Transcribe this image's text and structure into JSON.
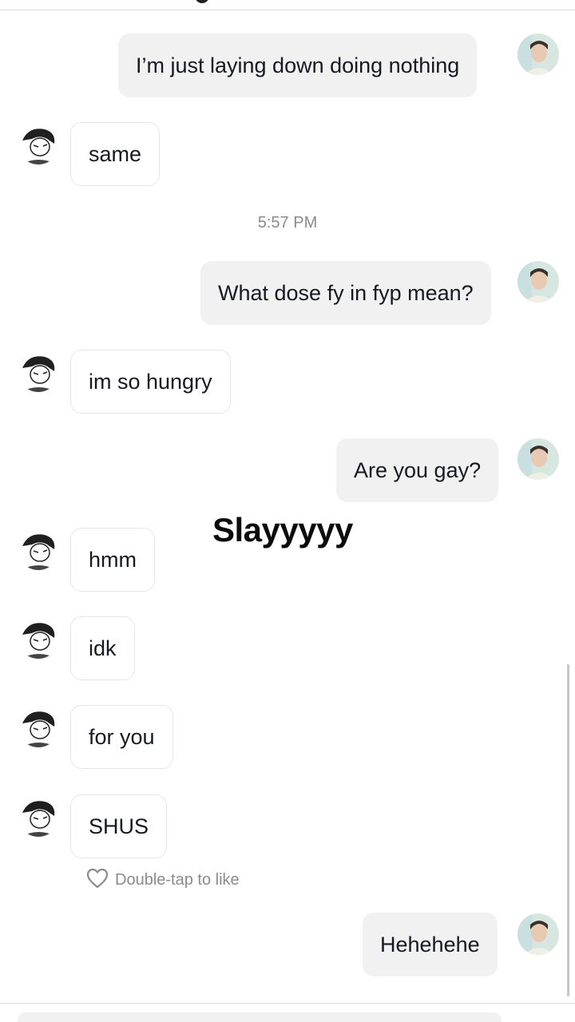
{
  "messages": [
    {
      "side": "sent",
      "text": "I’m just laying down doing nothing"
    },
    {
      "side": "received",
      "text": "same"
    },
    {
      "side": "sent",
      "text": "What dose fy in fyp mean?"
    },
    {
      "side": "received",
      "text": "im so hungry"
    },
    {
      "side": "sent",
      "text": "Are you gay?"
    },
    {
      "side": "received",
      "text": "hmm"
    },
    {
      "side": "received",
      "text": "idk"
    },
    {
      "side": "received",
      "text": "for you"
    },
    {
      "side": "received",
      "text": "SHUS"
    },
    {
      "side": "sent",
      "text": "Hehehehe"
    }
  ],
  "timestamp": "5:57 PM",
  "overlay_caption": "Slayyyyy",
  "like_hint": {
    "icon": "heart-outline-icon",
    "text": "Double-tap to like"
  },
  "colors": {
    "sent_bubble": "#f1f1f2",
    "received_bubble_border": "#e6e6e8",
    "text": "#161823",
    "muted": "#8a8b91"
  }
}
